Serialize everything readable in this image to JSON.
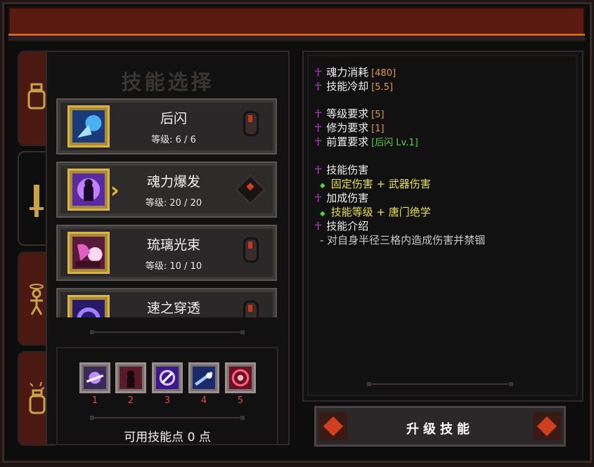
{
  "panel_title": "技能选择",
  "tabs": [
    {
      "icon": "pot-icon"
    },
    {
      "icon": "sword-icon"
    },
    {
      "icon": "figure-icon"
    },
    {
      "icon": "potion-icon"
    }
  ],
  "skills": [
    {
      "name": "后闪",
      "level": "等级: 6 / 6",
      "color": "#3aa0e0"
    },
    {
      "name": "魂力爆发",
      "level": "等级: 20 / 20",
      "color": "#8a40d8"
    },
    {
      "name": "琉璃光束",
      "level": "等级: 10 / 10",
      "color": "#c040b0"
    },
    {
      "name": "速之穿透",
      "level": "",
      "color": "#5a40d0"
    }
  ],
  "slots": [
    {
      "num": "1",
      "color": "#6a4ab0"
    },
    {
      "num": "2",
      "color": "#9a2a3a"
    },
    {
      "num": "3",
      "color": "#6a3ad0"
    },
    {
      "num": "4",
      "color": "#3a6ad0"
    },
    {
      "num": "5",
      "color": "#c02040"
    }
  ],
  "points_text": "可用技能点 0 点",
  "info": {
    "soul_cost_label": "魂力消耗",
    "soul_cost_value": "[480]",
    "cooldown_label": "技能冷却",
    "cooldown_value": "[5.5]",
    "level_req_label": "等级要求",
    "level_req_value": "[5]",
    "cult_req_label": "修为要求",
    "cult_req_value": "[1]",
    "prereq_label": "前置要求",
    "prereq_value": "[后闪 Lv.1]",
    "damage_label": "技能伤害",
    "damage_formula": "固定伤害 + 武器伤害",
    "bonus_label": "加成伤害",
    "bonus_formula": "技能等级 + 唐门绝学",
    "intro_label": "技能介绍",
    "intro_text": "- 对自身半径三格内造成伤害并禁锢"
  },
  "upgrade_button": "升级技能",
  "colors": {
    "accent": "#d4641e",
    "glyph": "#c040d8",
    "gold": "#d8b44a"
  }
}
